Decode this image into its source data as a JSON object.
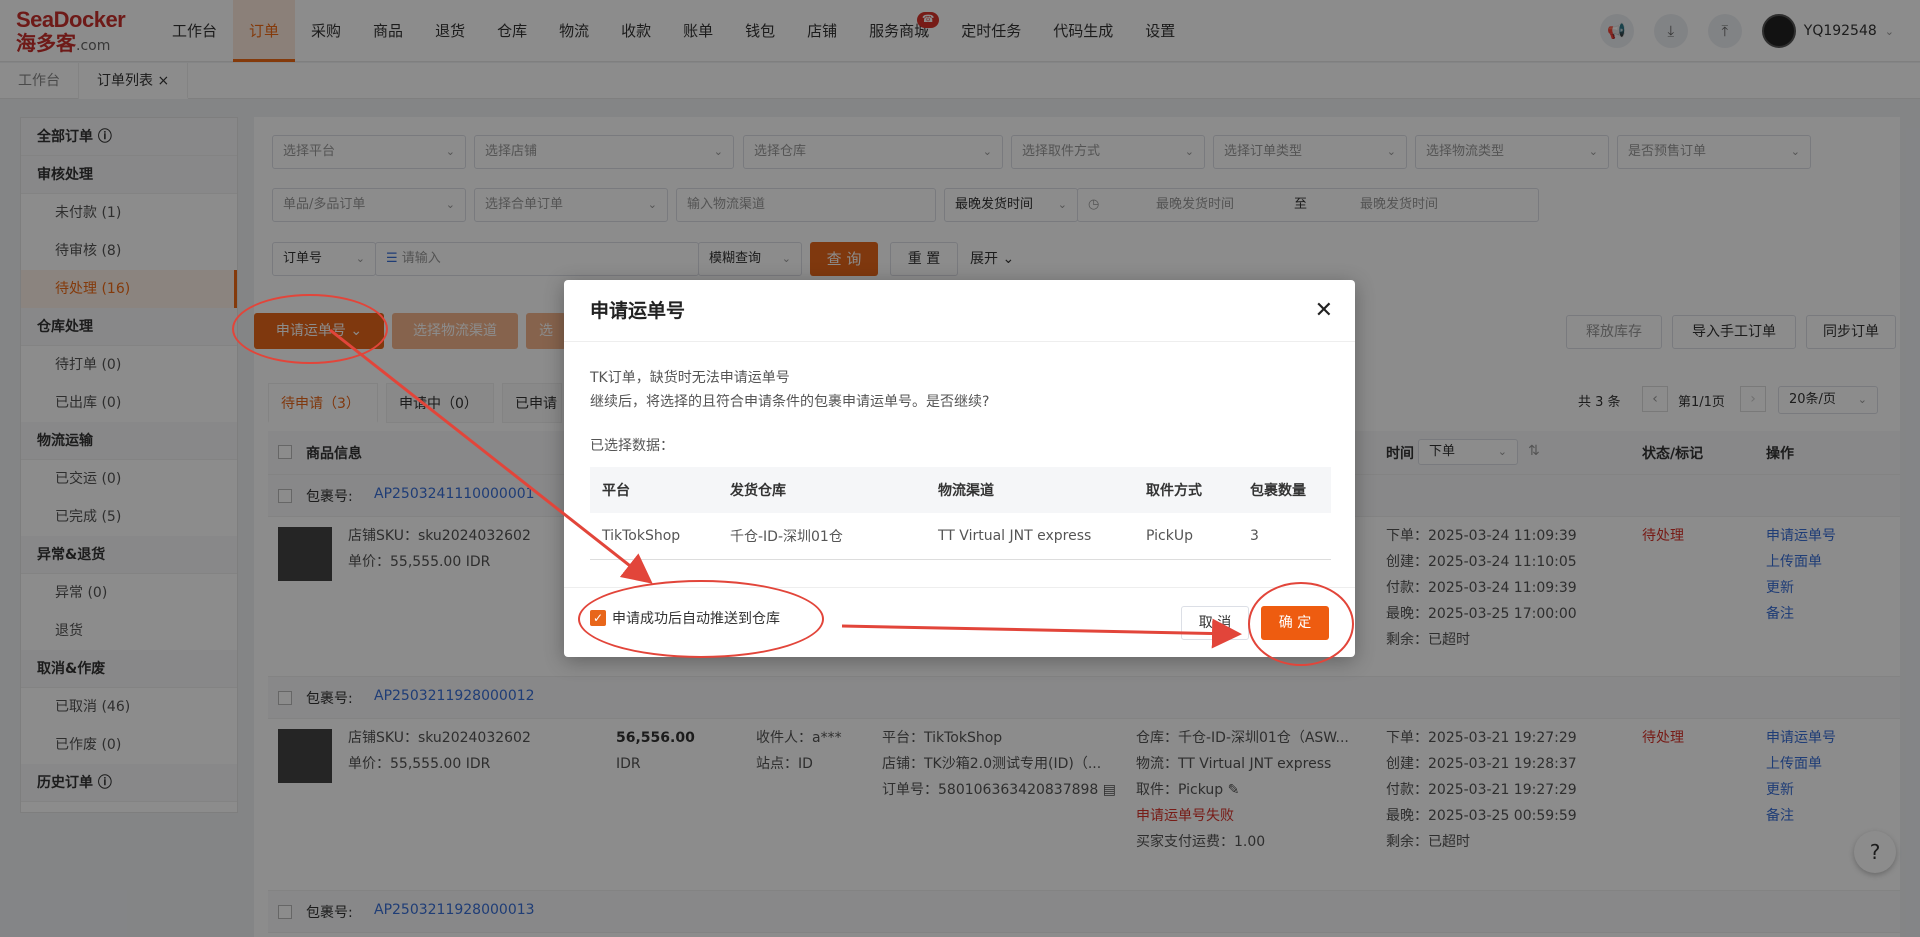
{
  "logo": {
    "brand": "SeaDocker",
    "cn": "海多客",
    "domain": ".com"
  },
  "nav": [
    {
      "label": "工作台"
    },
    {
      "label": "订单",
      "active": true
    },
    {
      "label": "采购"
    },
    {
      "label": "商品"
    },
    {
      "label": "退货"
    },
    {
      "label": "仓库"
    },
    {
      "label": "物流"
    },
    {
      "label": "收款"
    },
    {
      "label": "账单"
    },
    {
      "label": "钱包"
    },
    {
      "label": "店铺"
    },
    {
      "label": "服务商城"
    },
    {
      "label": "定时任务"
    },
    {
      "label": "代码生成"
    },
    {
      "label": "设置"
    }
  ],
  "user": {
    "name": "YQ192548"
  },
  "pagetabs": [
    {
      "label": "工作台"
    },
    {
      "label": "订单列表 ×",
      "active": true
    }
  ],
  "sidebar": [
    {
      "type": "group",
      "label": "全部订单 ⓘ"
    },
    {
      "type": "group",
      "label": "审核处理"
    },
    {
      "type": "item",
      "label": "未付款 (1)"
    },
    {
      "type": "item",
      "label": "待审核 (8)"
    },
    {
      "type": "item",
      "label": "待处理 (16)",
      "active": true
    },
    {
      "type": "group",
      "label": "仓库处理"
    },
    {
      "type": "item",
      "label": "待打单 (0)"
    },
    {
      "type": "item",
      "label": "已出库 (0)"
    },
    {
      "type": "group",
      "label": "物流运输"
    },
    {
      "type": "item",
      "label": "已交运 (0)"
    },
    {
      "type": "item",
      "label": "已完成 (5)"
    },
    {
      "type": "group",
      "label": "异常&退货"
    },
    {
      "type": "item",
      "label": "异常 (0)"
    },
    {
      "type": "item",
      "label": "退货"
    },
    {
      "type": "group",
      "label": "取消&作废"
    },
    {
      "type": "item",
      "label": "已取消 (46)"
    },
    {
      "type": "item",
      "label": "已作废 (0)"
    },
    {
      "type": "group",
      "label": "历史订单 ⓘ"
    }
  ],
  "filters": {
    "row1": [
      "选择平台",
      "选择店铺",
      "选择仓库",
      "选择取件方式",
      "选择订单类型",
      "选择物流类型",
      "是否预售订单"
    ],
    "row2": [
      "单品/多品订单",
      "选择合单订单",
      "输入物流渠道",
      "最晚发货时间"
    ],
    "date_start": "最晚发货时间",
    "date_to": "至",
    "date_end": "最晚发货时间",
    "order_no": "订单号",
    "input_ph": "请输入",
    "fuzzy": "模糊查询",
    "query": "查 询",
    "reset": "重 置",
    "expand": "展开"
  },
  "actions": {
    "apply": "申请运单号",
    "select_channel": "选择物流渠道",
    "more": "选",
    "release": "释放库存",
    "import": "导入手工订单",
    "sync": "同步订单"
  },
  "status_tabs": [
    "待申请（3）",
    "申请中（0）",
    "已申请"
  ],
  "pagination": {
    "total": "共 3 条",
    "page": "第1/1页",
    "size": "20条/页"
  },
  "table_head": {
    "product": "商品信息",
    "time": "时间",
    "time_sel": "下单",
    "status": "状态/标记",
    "ops": "操作"
  },
  "orders": [
    {
      "pkg_label": "包裹号:",
      "pkg": "AP2503241110000001",
      "sku": "店铺SKU：sku2024032602",
      "price": "单价：55,555.00 IDR",
      "times": [
        "下单：2025-03-24 11:09:39",
        "创建：2025-03-24 11:10:05",
        "付款：2025-03-24 11:09:39",
        "最晚：2025-03-25 17:00:00",
        "剩余：已超时"
      ],
      "status": "待处理",
      "ops": [
        "申请运单号",
        "上传面单",
        "更新",
        "备注"
      ]
    },
    {
      "pkg_label": "包裹号:",
      "pkg": "AP2503211928000012",
      "sku": "店铺SKU：sku2024032602",
      "price": "单价：55,555.00 IDR",
      "amount": "56,556.00",
      "currency": "IDR",
      "recv": [
        "收件人：a***",
        "站点：ID"
      ],
      "plat": [
        "平台：TikTokShop",
        "店铺：TK沙箱2.0测试专用(ID)（...",
        "订单号：580106363420837898 ▤"
      ],
      "wh": [
        "仓库：千仓-ID-深圳01仓（ASW...",
        "物流：TT Virtual JNT express",
        "取件：Pickup ✎",
        "申请运单号失败",
        "买家支付运费：1.00"
      ],
      "times": [
        "下单：2025-03-21 19:27:29",
        "创建：2025-03-21 19:28:37",
        "付款：2025-03-21 19:27:29",
        "最晚：2025-03-25 00:59:59",
        "剩余：已超时"
      ],
      "status": "待处理",
      "ops": [
        "申请运单号",
        "上传面单",
        "更新",
        "备注"
      ]
    },
    {
      "pkg_label": "包裹号:",
      "pkg": "AP2503211928000013"
    }
  ],
  "modal": {
    "title": "申请运单号",
    "msg1": "TK订单，缺货时无法申请运单号",
    "msg2": "继续后，将选择的且符合申请条件的包裹申请运单号。是否继续?",
    "selected": "已选择数据：",
    "headers": [
      "平台",
      "发货仓库",
      "物流渠道",
      "取件方式",
      "包裹数量"
    ],
    "row": [
      "TikTokShop",
      "千仓-ID-深圳01仓",
      "TT Virtual JNT express",
      "PickUp",
      "3"
    ],
    "checkbox": "申请成功后自动推送到仓库",
    "cancel": "取 消",
    "ok": "确 定"
  },
  "colors": {
    "accent": "#e8661a",
    "annotation": "#e2453a"
  }
}
